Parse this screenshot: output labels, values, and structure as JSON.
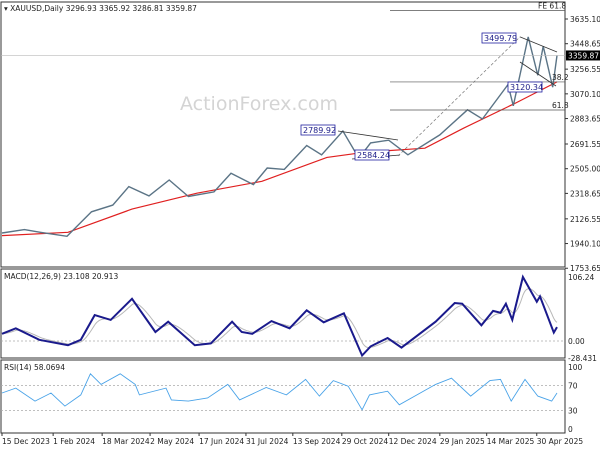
{
  "header": {
    "symbol": "XAUUSD,Daily",
    "ohlc": "3296.93 3365.92 3286.81 3359.87"
  },
  "watermark": "ActionForex.com",
  "colors": {
    "price": "#5b7486",
    "ma": "#e02020",
    "macd": "#1a1a8c",
    "signal": "#b8b8b8",
    "rsi": "#4aa3e8",
    "label_border": "#2020a0"
  },
  "x_axis": {
    "ticks": [
      "15 Dec 2023",
      "1 Feb 2024",
      "18 Mar 2024",
      "2 May 2024",
      "17 Jun 2024",
      "31 Jul 2024",
      "13 Sep 2024",
      "29 Oct 2024",
      "12 Dec 2024",
      "29 Jan 2025",
      "14 Mar 2025",
      "30 Apr 2025"
    ],
    "tick_dates": [
      "2023-12-15",
      "2024-02-01",
      "2024-03-18",
      "2024-05-02",
      "2024-06-17",
      "2024-07-31",
      "2024-09-13",
      "2024-10-29",
      "2024-12-12",
      "2025-01-29",
      "2025-03-14",
      "2025-04-30"
    ],
    "range": [
      "2023-12-15",
      "2025-05-19"
    ]
  },
  "annotations": {
    "price_labels": [
      "3499.79",
      "2789.92",
      "2584.24",
      "3120.34"
    ],
    "fib_labels": [
      "FE 61.8",
      "38.2",
      "61.8"
    ],
    "fib_levels": [
      3700,
      3160,
      2948
    ],
    "current_price": "3359.87"
  },
  "chart_data": [
    {
      "type": "line",
      "title": "XAUUSD,Daily",
      "y_ticks": [
        "3635.10",
        "3448.65",
        "3256.55",
        "3070.10",
        "2883.65",
        "2691.55",
        "2505.00",
        "2318.65",
        "2126.55",
        "1940.10",
        "1753.65"
      ],
      "ylim": [
        1753.65,
        3700
      ],
      "series": [
        {
          "values": [
            [
              "2023-12-15",
              2020
            ],
            [
              "2024-01-05",
              2045
            ],
            [
              "2024-01-20",
              2025
            ],
            [
              "2024-02-14",
              1995
            ],
            [
              "2024-03-08",
              2180
            ],
            [
              "2024-03-28",
              2230
            ],
            [
              "2024-04-12",
              2370
            ],
            [
              "2024-05-01",
              2300
            ],
            [
              "2024-05-20",
              2420
            ],
            [
              "2024-06-07",
              2295
            ],
            [
              "2024-07-01",
              2330
            ],
            [
              "2024-07-17",
              2470
            ],
            [
              "2024-08-07",
              2385
            ],
            [
              "2024-08-20",
              2510
            ],
            [
              "2024-09-05",
              2500
            ],
            [
              "2024-09-26",
              2680
            ],
            [
              "2024-10-10",
              2610
            ],
            [
              "2024-10-30",
              2789.92
            ],
            [
              "2024-11-14",
              2584.24
            ],
            [
              "2024-11-25",
              2700
            ],
            [
              "2024-12-12",
              2720
            ],
            [
              "2024-12-30",
              2610
            ],
            [
              "2025-01-29",
              2760
            ],
            [
              "2025-02-24",
              2950
            ],
            [
              "2025-03-10",
              2880
            ],
            [
              "2025-04-03",
              3140
            ],
            [
              "2025-04-08",
              2980
            ],
            [
              "2025-04-22",
              3499.79
            ],
            [
              "2025-05-01",
              3210
            ],
            [
              "2025-05-06",
              3430
            ],
            [
              "2025-05-15",
              3120.34
            ],
            [
              "2025-05-19",
              3359.87
            ]
          ]
        },
        {
          "values": [
            [
              "2023-12-15",
              2000
            ],
            [
              "2024-02-15",
              2025
            ],
            [
              "2024-04-15",
              2200
            ],
            [
              "2024-06-15",
              2320
            ],
            [
              "2024-08-15",
              2410
            ],
            [
              "2024-10-15",
              2590
            ],
            [
              "2024-11-20",
              2630
            ],
            [
              "2025-01-15",
              2660
            ],
            [
              "2025-02-20",
              2810
            ],
            [
              "2025-04-10",
              3000
            ],
            [
              "2025-05-19",
              3160
            ]
          ]
        }
      ]
    },
    {
      "type": "line",
      "title": "MACD(12,26,9) 23.108 20.913",
      "y_ticks": [
        "106.24",
        "0.00",
        "-28.431"
      ],
      "series": [
        {
          "values": [
            [
              "2023-12-15",
              12
            ],
            [
              "2023-12-28",
              21
            ],
            [
              "2024-01-19",
              2
            ],
            [
              "2024-02-15",
              -7
            ],
            [
              "2024-02-27",
              2
            ],
            [
              "2024-03-11",
              43
            ],
            [
              "2024-03-26",
              35
            ],
            [
              "2024-04-15",
              70
            ],
            [
              "2024-05-07",
              15
            ],
            [
              "2024-05-19",
              32
            ],
            [
              "2024-06-13",
              -7
            ],
            [
              "2024-06-28",
              -4
            ],
            [
              "2024-07-18",
              32
            ],
            [
              "2024-07-27",
              15
            ],
            [
              "2024-08-06",
              12
            ],
            [
              "2024-08-24",
              33
            ],
            [
              "2024-09-10",
              21
            ],
            [
              "2024-09-26",
              51
            ],
            [
              "2024-10-12",
              31
            ],
            [
              "2024-10-31",
              46
            ],
            [
              "2024-11-17",
              -24
            ],
            [
              "2024-11-25",
              -9
            ],
            [
              "2024-12-11",
              5
            ],
            [
              "2024-12-24",
              -11
            ],
            [
              "2025-01-25",
              32
            ],
            [
              "2025-02-12",
              63
            ],
            [
              "2025-02-19",
              62
            ],
            [
              "2025-03-09",
              26
            ],
            [
              "2025-03-20",
              50
            ],
            [
              "2025-03-27",
              47
            ],
            [
              "2025-04-01",
              62
            ],
            [
              "2025-04-07",
              35
            ],
            [
              "2025-04-17",
              106.24
            ],
            [
              "2025-04-30",
              65
            ],
            [
              "2025-05-03",
              74
            ],
            [
              "2025-05-16",
              14
            ],
            [
              "2025-05-19",
              23.108
            ]
          ]
        }
      ]
    },
    {
      "type": "line",
      "title": "RSI(14) 58.0694",
      "y_ticks": [
        "100",
        "70",
        "30",
        "0"
      ],
      "ylim": [
        0,
        100
      ],
      "series": [
        {
          "values": [
            [
              "2023-12-15",
              58
            ],
            [
              "2023-12-28",
              66
            ],
            [
              "2024-01-15",
              45
            ],
            [
              "2024-01-30",
              58
            ],
            [
              "2024-02-12",
              37
            ],
            [
              "2024-02-27",
              55
            ],
            [
              "2024-03-07",
              89
            ],
            [
              "2024-03-17",
              72
            ],
            [
              "2024-04-04",
              89
            ],
            [
              "2024-04-18",
              72
            ],
            [
              "2024-04-22",
              55
            ],
            [
              "2024-05-17",
              66
            ],
            [
              "2024-05-22",
              47
            ],
            [
              "2024-06-07",
              45
            ],
            [
              "2024-06-25",
              50
            ],
            [
              "2024-07-14",
              72
            ],
            [
              "2024-07-25",
              47
            ],
            [
              "2024-08-19",
              67
            ],
            [
              "2024-09-07",
              55
            ],
            [
              "2024-09-25",
              80
            ],
            [
              "2024-10-08",
              53
            ],
            [
              "2024-10-21",
              78
            ],
            [
              "2024-11-04",
              69
            ],
            [
              "2024-11-17",
              31
            ],
            [
              "2024-11-24",
              55
            ],
            [
              "2024-12-11",
              61
            ],
            [
              "2024-12-22",
              39
            ],
            [
              "2025-01-25",
              72
            ],
            [
              "2025-02-09",
              82
            ],
            [
              "2025-02-27",
              53
            ],
            [
              "2025-03-17",
              78
            ],
            [
              "2025-03-27",
              80
            ],
            [
              "2025-04-06",
              45
            ],
            [
              "2025-04-19",
              80
            ],
            [
              "2025-05-01",
              53
            ],
            [
              "2025-05-14",
              45
            ],
            [
              "2025-05-19",
              58.0694
            ]
          ]
        }
      ]
    }
  ]
}
